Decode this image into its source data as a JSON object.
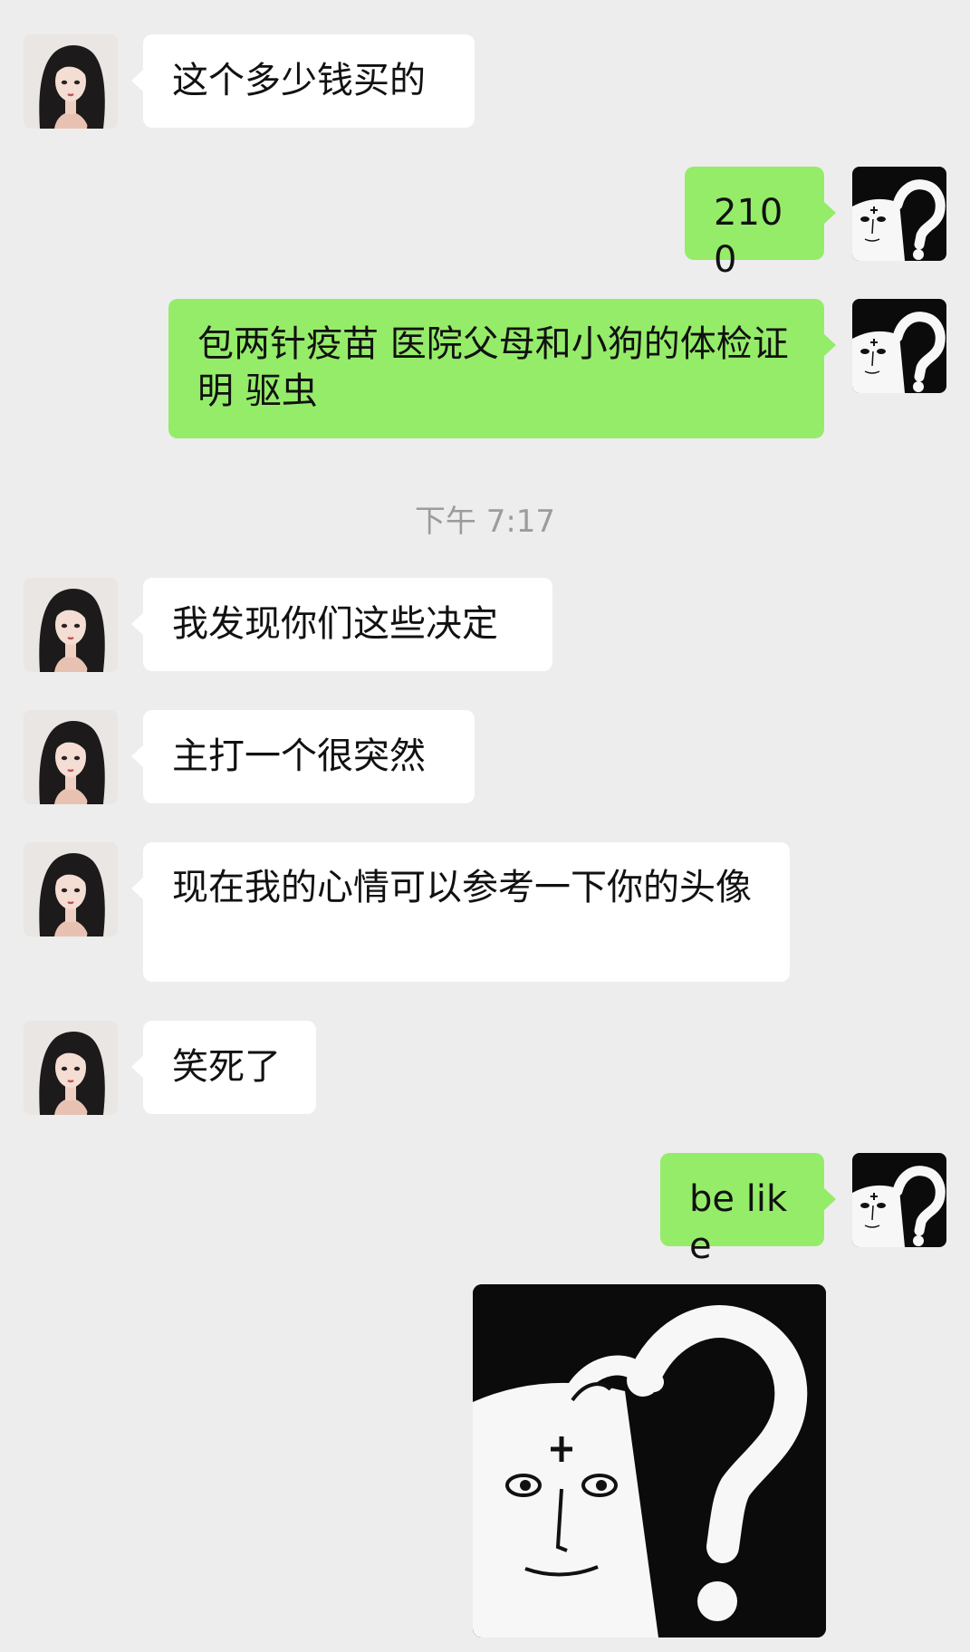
{
  "chat": {
    "timestamp": "下午 7:17",
    "messages": [
      {
        "side": "in",
        "text": "这个多少钱买的"
      },
      {
        "side": "out",
        "text": "2100"
      },
      {
        "side": "out",
        "text": "包两针疫苗 医院父母和小狗的体检证明 驱虫"
      },
      {
        "side": "in",
        "text": "我发现你们这些决定"
      },
      {
        "side": "in",
        "text": "主打一个很突然"
      },
      {
        "side": "in",
        "text": "现在我的心情可以参考一下你的头像"
      },
      {
        "side": "in",
        "text": "笑死了"
      },
      {
        "side": "out",
        "text": "be like"
      },
      {
        "side": "out",
        "type": "image",
        "image": "question-mark-meme"
      }
    ]
  },
  "avatars": {
    "contact": "girl-avatar-icon",
    "self": "question-mark-meme-avatar-icon"
  },
  "colors": {
    "background": "#ededed",
    "incoming_bubble": "#ffffff",
    "outgoing_bubble": "#95ec69",
    "timestamp_text": "#9c9c9c"
  }
}
